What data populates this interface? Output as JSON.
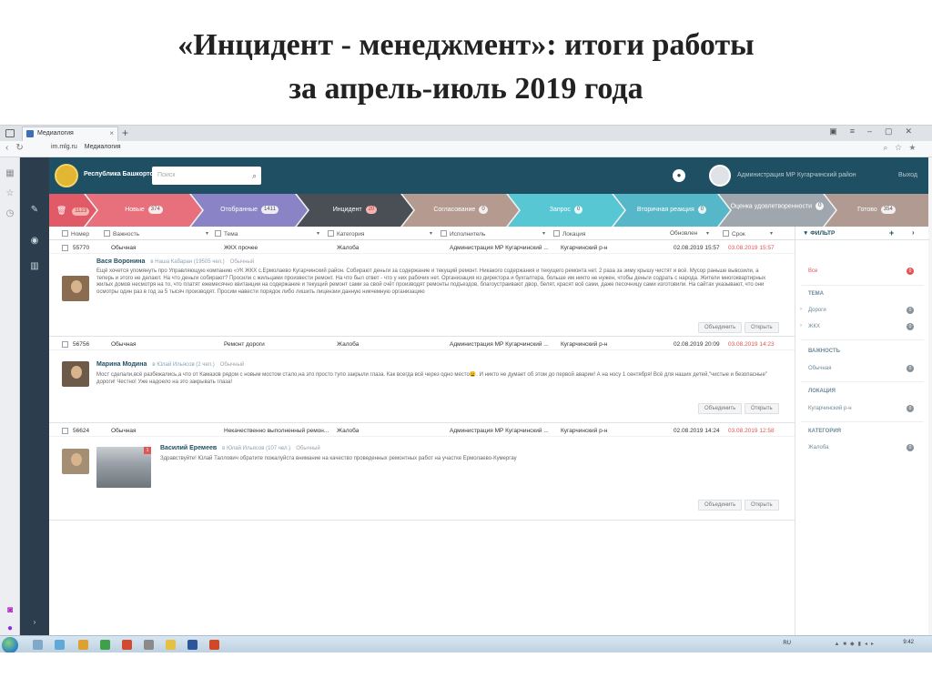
{
  "slide": {
    "title_line1": "«Инцидент - менеджмент»: итоги работы",
    "title_line2": "за апрель-июль 2019 года"
  },
  "browser": {
    "tab_title": "Медиалогия",
    "url_host": "im.mlg.ru",
    "url_title": "Медиалогия"
  },
  "header": {
    "region": "Республика Башкортостан",
    "search_placeholder": "Поиск",
    "user": "Администрация МР Кугарчинский район",
    "logout": "Выход"
  },
  "statuses": [
    {
      "label": "",
      "count": "1123",
      "color": "#e05a68"
    },
    {
      "label": "Новые",
      "count": "374",
      "color": "#e8707c"
    },
    {
      "label": "Отобранные",
      "count": "1411",
      "color": "#8a84c6"
    },
    {
      "label": "Инцидент",
      "count": "20",
      "color": "#4a4f56"
    },
    {
      "label": "Согласование",
      "count": "0",
      "color": "#b59a8f"
    },
    {
      "label": "Запрос",
      "count": "0",
      "color": "#57c7d4"
    },
    {
      "label": "Вторичная реакция",
      "count": "0",
      "color": "#55b7c8"
    },
    {
      "label": "Оценка удовлетворенности",
      "count": "0",
      "color": "#a0a6ad"
    },
    {
      "label": "Готово",
      "count": "354",
      "color": "#b09a92"
    }
  ],
  "columns": [
    "Номер",
    "Важность",
    "Тема",
    "Категория",
    "Исполнитель",
    "Локация",
    "Обновлен",
    "Срок"
  ],
  "incidents": [
    {
      "number": "55770",
      "importance": "Обычная",
      "topic": "ЖКХ прочее",
      "category": "Жалоба",
      "executor": "Администрация МР Кугарчинский ...",
      "location": "Кугарчинский р-н",
      "updated": "02.08.2019 15:57",
      "due": "03.08.2019 15:57",
      "author": "Вася Воронина",
      "source": "в Наша Кабаран (19505 чел.)",
      "tag": "Обычный",
      "text": "Ещё хочется упомянуть про Управляющую компанию «УК ЖКХ с.Ермолаево Кугарчинский район. Собирают деньги за содержание и текущий ремонт. Никакого содержания и текущего ремонта нет. 2 раза за зиму крышу чистят и всё. Мусор раньше вывозили, а теперь и этого не делают. На что деньги собирают? Просили с жильцами произвести ремонт. На что был ответ - что у них рабочих нет. Организация из директора и бухгалтера, больше им никто не нужен, чтобы деньги содрать с народа. Жители многоквартирных жилых домов несмотря на то, что платят ежемесячно квитанции на содержание и текущий ремонт сами за свой счёт производят ремонты подъездов, благоустраивают двор, белят, красят всё сами, даже песочницу сами изготовили. На сайтах указывают, что они осмотры один раз в год за 5 тысяч производят. Просим навести порядок либо лишить лицензии данную никчемную организацию",
      "btn_merge": "Объединить",
      "btn_open": "Открыть"
    },
    {
      "number": "56756",
      "importance": "Обычная",
      "topic": "Ремонт дороги",
      "category": "Жалоба",
      "executor": "Администрация МР Кугарчинский ...",
      "location": "Кугарчинский р-н",
      "updated": "02.08.2019 20:09",
      "due": "03.08.2019 14:23",
      "author": "Марина Модина",
      "source": "в Юлай Ильясов (2 чел.)",
      "tag": "Обычный",
      "text": "Мост сделали,всё разбежались,а что от Камазов рядом с новым мостом стало,на это просто тупо закрыли глаза. Как всегда всё через одно место😩. И никто не думает об этом до первой аварии! А на носу 1 сентября! Всё для наших детей,\"чистые и безопасные\" дороги! Честно! Уже надоело на это закрывать глаза!",
      "btn_merge": "Объединить",
      "btn_open": "Открыть"
    },
    {
      "number": "56624",
      "importance": "Обычная",
      "topic": "Некачественно выполненный ремон...",
      "category": "Жалоба",
      "executor": "Администрация МР Кугарчинский ...",
      "location": "Кугарчинский р-н",
      "updated": "02.08.2019 14:24",
      "due": "03.08.2019 12:58",
      "author": "Василий Еремеев",
      "source": "в Юлай Ильясов (107 чел.)",
      "tag": "Обычный",
      "text": "Здравствуйте! Юлай Таллович обратите пожалуйста внимание на качество проведенных ремонтных работ на участке Ермолаево-Кумергау",
      "btn_merge": "Объединить",
      "btn_open": "Открыть"
    }
  ],
  "filters": {
    "title": "ФИЛЬТР",
    "all_label": "Все",
    "all_count": "0",
    "sections": [
      {
        "title": "ТЕМА",
        "items": [
          {
            "label": "Дороги",
            "count": "0"
          },
          {
            "label": "ЖКХ",
            "count": "0"
          }
        ]
      },
      {
        "title": "ВАЖНОСТЬ",
        "items": [
          {
            "label": "Обычная",
            "count": "0"
          }
        ]
      },
      {
        "title": "ЛОКАЦИЯ",
        "items": [
          {
            "label": "Кугарчинский р-н",
            "count": "0"
          }
        ]
      },
      {
        "title": "КАТЕГОРИЯ",
        "items": [
          {
            "label": "Жалоба",
            "count": "0"
          }
        ]
      }
    ]
  },
  "taskbar": {
    "lang": "RU",
    "time": "9:42"
  }
}
